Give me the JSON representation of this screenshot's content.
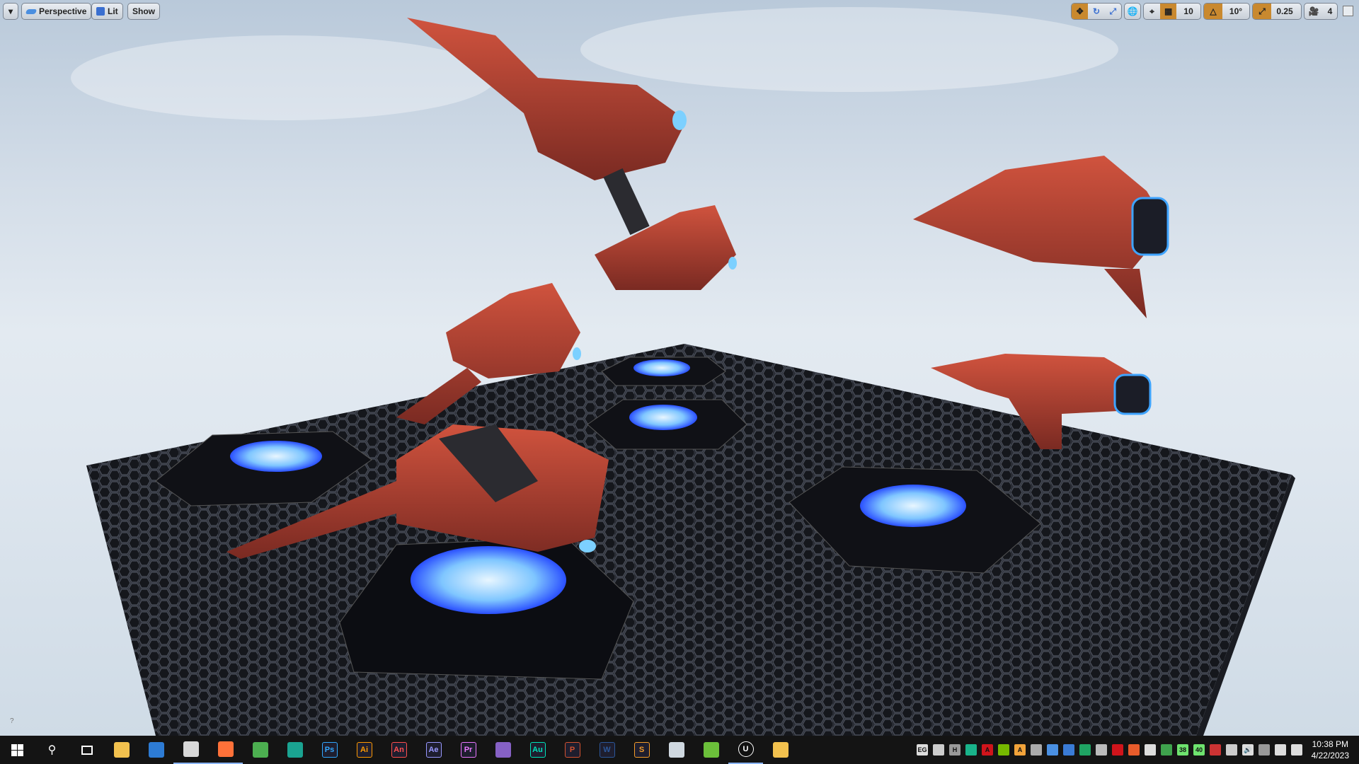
{
  "viewport_toolbar": {
    "left": {
      "options_label": "▾",
      "perspective_label": "Perspective",
      "lit_label": "Lit",
      "show_label": "Show"
    },
    "right": {
      "grid_snap_value": "10",
      "rotation_snap_value": "10°",
      "scale_snap_value": "0.25",
      "camera_speed_value": "4"
    }
  },
  "taskbar": {
    "apps": [
      {
        "name": "file-explorer",
        "label": "",
        "color": "#f2c14e"
      },
      {
        "name": "app-blue",
        "label": "",
        "color": "#2d7bd4"
      },
      {
        "name": "paint",
        "label": "",
        "color": "#d8d8d8"
      },
      {
        "name": "firefox",
        "label": "",
        "color": "#ff7139"
      },
      {
        "name": "chrome",
        "label": "",
        "color": "#4caf50"
      },
      {
        "name": "app-teal",
        "label": "",
        "color": "#1aa391"
      },
      {
        "name": "photoshop",
        "label": "Ps",
        "color": "#31a8ff"
      },
      {
        "name": "illustrator",
        "label": "Ai",
        "color": "#ff9a00"
      },
      {
        "name": "animate",
        "label": "An",
        "color": "#ff4f4f"
      },
      {
        "name": "after-effects",
        "label": "Ae",
        "color": "#9999ff"
      },
      {
        "name": "premiere",
        "label": "Pr",
        "color": "#ea77ff"
      },
      {
        "name": "visual-studio",
        "label": "",
        "color": "#8661c5"
      },
      {
        "name": "audition",
        "label": "Au",
        "color": "#00e4bb"
      },
      {
        "name": "powerpoint",
        "label": "P",
        "color": "#d35230"
      },
      {
        "name": "word",
        "label": "W",
        "color": "#2b579a"
      },
      {
        "name": "sublime",
        "label": "S",
        "color": "#f59d2a"
      },
      {
        "name": "notepad",
        "label": "",
        "color": "#cfd8e0"
      },
      {
        "name": "app-green",
        "label": "",
        "color": "#6bbf3a"
      },
      {
        "name": "unreal-engine",
        "label": "U",
        "color": "#ffffff"
      },
      {
        "name": "folder",
        "label": "",
        "color": "#f2c14e"
      }
    ],
    "tray": [
      {
        "name": "epic",
        "label": "EG",
        "color": "#ddd"
      },
      {
        "name": "lock",
        "label": "",
        "color": "#ccc"
      },
      {
        "name": "network-h",
        "label": "H",
        "color": "#999"
      },
      {
        "name": "shield",
        "label": "",
        "color": "#19b38a"
      },
      {
        "name": "adobe",
        "label": "A",
        "color": "#d0141b"
      },
      {
        "name": "nvidia",
        "label": "",
        "color": "#76b900"
      },
      {
        "name": "app-a",
        "label": "A",
        "color": "#f2a33a"
      },
      {
        "name": "steam",
        "label": "",
        "color": "#aaa"
      },
      {
        "name": "app-doc",
        "label": "",
        "color": "#4a90e2"
      },
      {
        "name": "app-circle",
        "label": "",
        "color": "#3a7bd5"
      },
      {
        "name": "app-leaf",
        "label": "",
        "color": "#1fa463"
      },
      {
        "name": "app-box",
        "label": "",
        "color": "#bbb"
      },
      {
        "name": "acrobat",
        "label": "",
        "color": "#d0141b"
      },
      {
        "name": "ccleaner",
        "label": "",
        "color": "#e85c2b"
      },
      {
        "name": "wifi",
        "label": "",
        "color": "#ddd"
      },
      {
        "name": "app-globe",
        "label": "",
        "color": "#3fa34d"
      },
      {
        "name": "temp-cpu",
        "label": "38",
        "color": "#6ee36e"
      },
      {
        "name": "temp-gpu",
        "label": "40",
        "color": "#6ee36e"
      },
      {
        "name": "app-red",
        "label": "",
        "color": "#c33"
      },
      {
        "name": "usb",
        "label": "",
        "color": "#ccc"
      },
      {
        "name": "volume",
        "label": "🔊",
        "color": "#ddd"
      },
      {
        "name": "onedrive",
        "label": "",
        "color": "#999"
      },
      {
        "name": "power",
        "label": "",
        "color": "#ddd"
      },
      {
        "name": "notifications",
        "label": "",
        "color": "#ddd"
      }
    ],
    "time": "10:38 PM",
    "date": "4/22/2023"
  }
}
